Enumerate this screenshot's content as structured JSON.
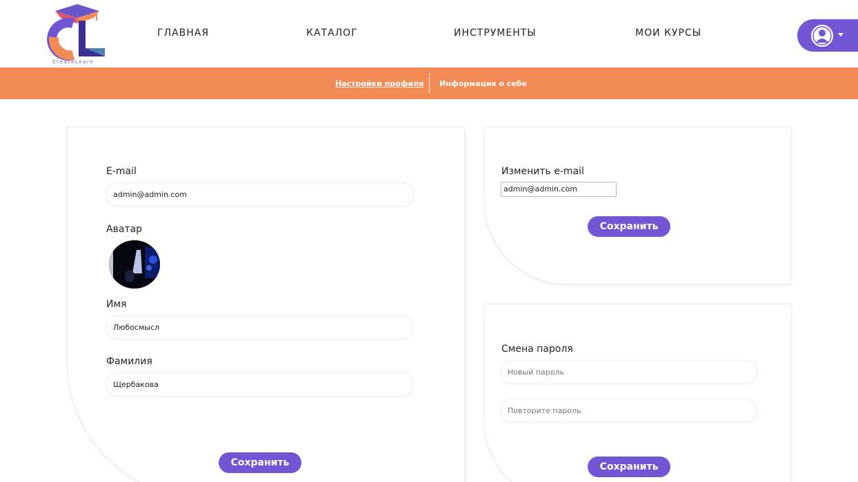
{
  "brand": {
    "name": "CreateLearn",
    "colors": {
      "primary": "#7155d3",
      "accent": "#f28b55"
    }
  },
  "nav": {
    "home": "ГЛАВНАЯ",
    "catalog": "КАТАЛОГ",
    "tools": "ИНСТРУМЕНТЫ",
    "my_courses": "МОИ КУРСЫ"
  },
  "user_menu": {
    "icon": "user-icon",
    "caret": "chevron-down-icon"
  },
  "subnav": {
    "profile_settings": "Настройки профиля",
    "about": "Информация о себе"
  },
  "profile_form": {
    "email_label": "E-mail",
    "email_value": "admin@admin.com",
    "avatar_label": "Аватар",
    "first_name_label": "Имя",
    "first_name_value": "Любосмысл",
    "last_name_label": "Фамилия",
    "last_name_value": "Щербакова",
    "save_label": "Сохранить"
  },
  "email_form": {
    "title": "Изменить e-mail",
    "email_value": "admin@admin.com",
    "save_label": "Сохранить"
  },
  "password_form": {
    "title": "Смена пароля",
    "new_password_placeholder": "Новый пароль",
    "repeat_password_placeholder": "Повторите пароль",
    "save_label": "Сохранить"
  }
}
